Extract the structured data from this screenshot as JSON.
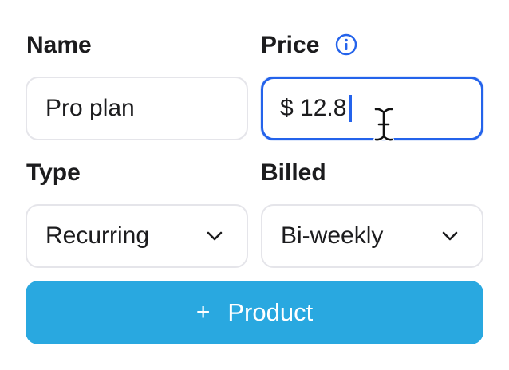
{
  "form": {
    "name_label": "Name",
    "price_label": "Price",
    "type_label": "Type",
    "billed_label": "Billed",
    "name_value": "Pro plan",
    "price_value": "$ 12.8",
    "type_value": "Recurring",
    "billed_value": "Bi-weekly",
    "submit_plus": "+",
    "submit_label": "Product"
  },
  "icons": {
    "info": "info-circle-icon",
    "chevron": "chevron-down-icon",
    "cursor": "text-cursor-icon"
  },
  "colors": {
    "accent_focus": "#2463eb",
    "button_bg": "#29a8e0",
    "button_text": "#ffffff",
    "field_border": "#e5e5ea",
    "text": "#1c1c1e"
  }
}
